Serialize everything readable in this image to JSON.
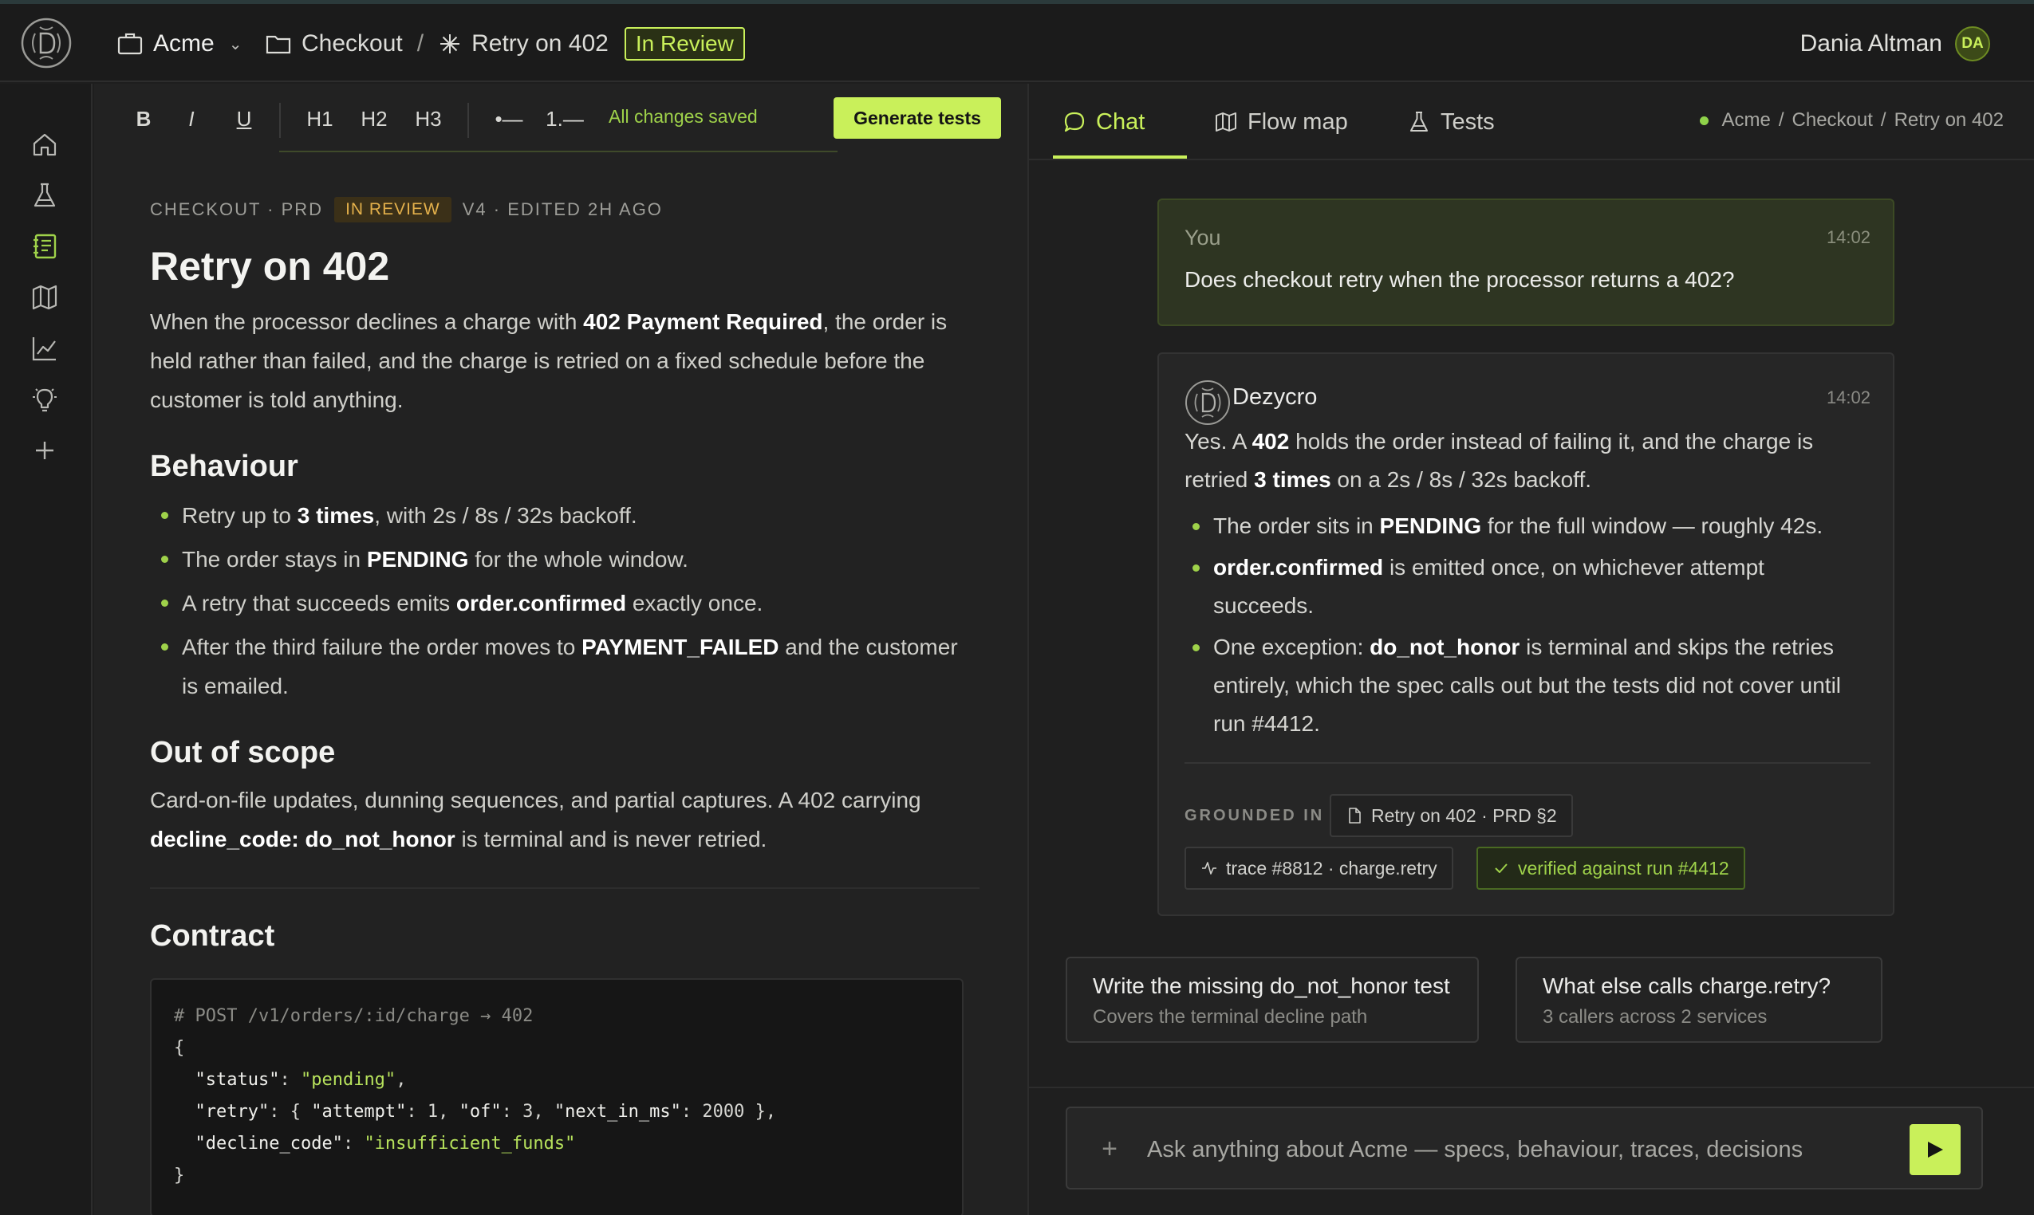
{
  "topbar": {
    "workspace": "Acme",
    "breadcrumb_folder": "Checkout",
    "breadcrumb_sep": "/",
    "breadcrumb_page": "Retry on 402",
    "status": "In Review",
    "user_name": "Dania Altman",
    "user_initials": "DA"
  },
  "rail": [
    "home-icon",
    "flask-icon",
    "notebook-icon",
    "map-icon",
    "chart-icon",
    "lightbulb-icon",
    "plus-icon"
  ],
  "toolbar": {
    "bold": "B",
    "italic": "I",
    "underline": "U",
    "h1": "H1",
    "h2": "H2",
    "h3": "H3",
    "bullet": "•—",
    "numbered": "1.—",
    "saved": "All changes saved",
    "generate": "Generate tests"
  },
  "doc": {
    "meta_section": "CHECKOUT · PRD",
    "meta_badge": "IN REVIEW",
    "meta_version": "V4 · EDITED 2H AGO",
    "title": "Retry on 402",
    "intro_a": "When the processor declines a charge with ",
    "intro_b": "402 Payment Required",
    "intro_c": ", the order is held rather than failed, and the charge is retried on a fixed schedule before the customer is told anything.",
    "behaviour_heading": "Behaviour",
    "behaviour": [
      {
        "a": "Retry up to ",
        "b": "3 times",
        "c": ", with 2s / 8s / 32s backoff."
      },
      {
        "a": "The order stays in ",
        "b": "PENDING",
        "c": " for the whole window."
      },
      {
        "a": "A retry that succeeds emits ",
        "b": "order.confirmed",
        "c": " exactly once."
      },
      {
        "a": "After the third failure the order moves to ",
        "b": "PAYMENT_FAILED",
        "c": " and the customer is emailed."
      }
    ],
    "scope_heading": "Out of scope",
    "scope_a": "Card-on-file updates, dunning sequences, and partial captures. A 402 carrying ",
    "scope_b": "decline_code: do_not_honor",
    "scope_c": " is terminal and is never retried.",
    "contract_heading": "Contract",
    "code": {
      "comment": "# POST /v1/orders/:id/charge → 402",
      "open": "{",
      "l1_key": "\"status\"",
      "l1_val": "\"pending\"",
      "l2_key": "\"retry\"",
      "l2_k1": "\"attempt\"",
      "l2_v1": "1",
      "l2_k2": "\"of\"",
      "l2_v2": "3",
      "l2_k3": "\"next_in_ms\"",
      "l2_v3": "2000",
      "l3_key": "\"decline_code\"",
      "l3_val": "\"insufficient_funds\"",
      "close": "}"
    }
  },
  "chat": {
    "tabs": [
      {
        "label": "Chat",
        "icon": "chat-bubble-icon"
      },
      {
        "label": "Flow map",
        "icon": "map-icon"
      },
      {
        "label": "Tests",
        "icon": "flask-icon"
      }
    ],
    "crumbs": [
      "Acme",
      "Checkout",
      "Retry on 402"
    ],
    "crumb_sep": "/",
    "user_msg": {
      "who": "You",
      "time": "14:02",
      "text": "Does checkout retry when the processor returns a 402?"
    },
    "bot_msg": {
      "who": "Dezycro",
      "time": "14:02",
      "p_a": "Yes. A ",
      "p_b": "402",
      "p_c": " holds the order instead of failing it, and the charge is retried ",
      "p_d": "3 times",
      "p_e": " on a 2s / 8s / 32s backoff.",
      "bullets": [
        {
          "a": "The order sits in ",
          "b": "PENDING",
          "c": " for the full window — roughly 42s."
        },
        {
          "a": "",
          "b": "order.confirmed",
          "c": " is emitted once, on whichever attempt succeeds."
        },
        {
          "a": "One exception: ",
          "b": "do_not_honor",
          "c": " is terminal and skips the retries entirely, which the spec calls out but the tests did not cover until run #4412."
        }
      ],
      "grounded_label": "GROUNDED IN",
      "chips": [
        "Retry on 402 · PRD §2",
        "trace #8812 · charge.retry",
        "verified against run #4412"
      ]
    },
    "suggestions": [
      {
        "title": "Write the missing do_not_honor test",
        "desc": "Covers the terminal decline path"
      },
      {
        "title": "What else calls charge.retry?",
        "desc": "3 callers across 2 services"
      }
    ],
    "composer_placeholder": "Ask anything about Acme — specs, behaviour, traces, decisions"
  },
  "colors": {
    "accent": "#c9f05a",
    "warning": "#e3b04b",
    "background": "#1e1e1e"
  }
}
